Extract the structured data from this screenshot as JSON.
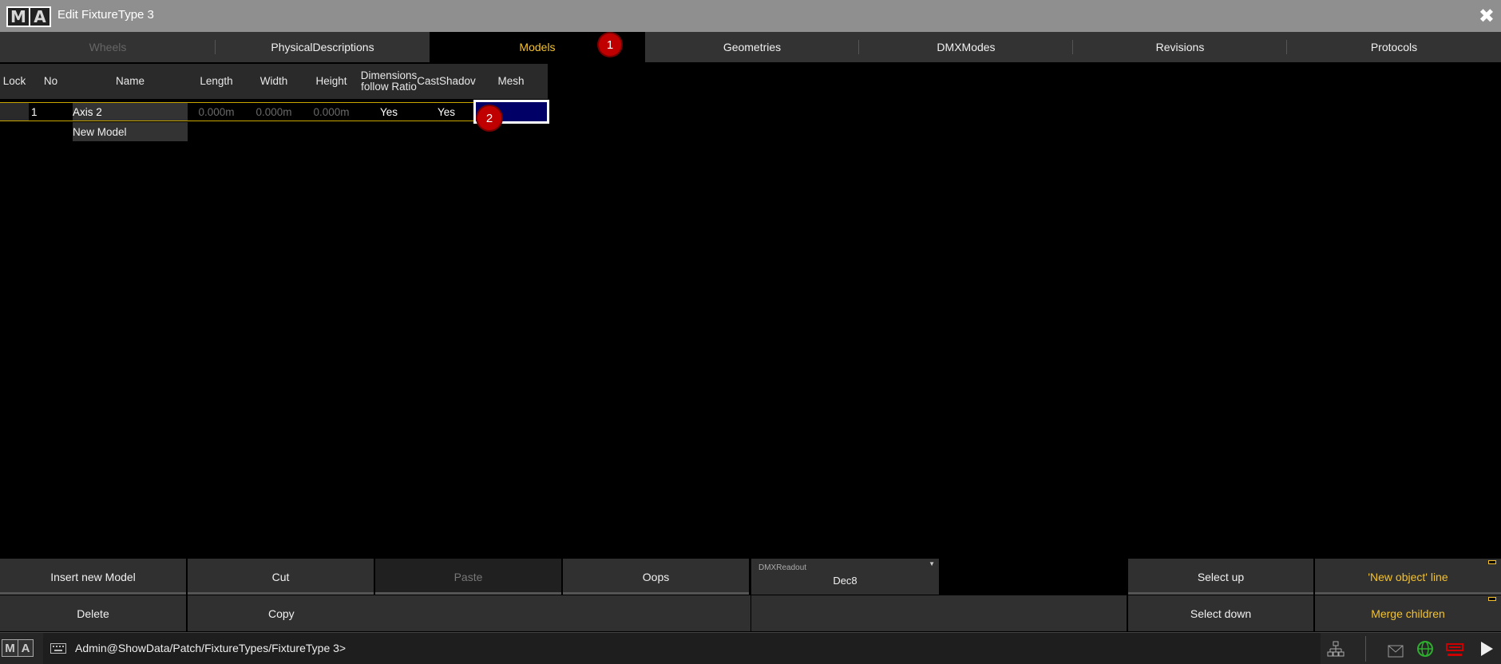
{
  "window": {
    "title": "Edit FixtureType 3",
    "logo_m": "M",
    "logo_a": "A",
    "close_icon": "✖"
  },
  "tabs": [
    {
      "label": "Wheels",
      "state": "disabled"
    },
    {
      "label": "PhysicalDescriptions",
      "state": "normal"
    },
    {
      "label": "Models",
      "state": "active"
    },
    {
      "label": "Geometries",
      "state": "normal"
    },
    {
      "label": "DMXModes",
      "state": "normal"
    },
    {
      "label": "Revisions",
      "state": "normal"
    },
    {
      "label": "Protocols",
      "state": "normal"
    }
  ],
  "badges": [
    "1",
    "2"
  ],
  "grid": {
    "columns": [
      "Lock",
      "No",
      "Name",
      "Length",
      "Width",
      "Height",
      "Dimensions\nfollow Ratio",
      "CastShadov",
      "Mesh"
    ],
    "rows": [
      {
        "lock": "",
        "no": "1",
        "name": "Axis 2",
        "length": "0.000m",
        "width": "0.000m",
        "height": "0.000m",
        "dimensions_follow_ratio": "Yes",
        "cast_shadow": "Yes",
        "mesh": ""
      }
    ],
    "new_row_label": "New Model"
  },
  "toolbar": {
    "insert_new": "Insert new Model",
    "cut": "Cut",
    "paste": "Paste",
    "oops": "Oops",
    "dmx_readout_label": "DMXReadout",
    "dmx_readout_value": "Dec8",
    "select_up": "Select up",
    "new_object_line": "'New object' line",
    "delete": "Delete",
    "copy": "Copy",
    "select_down": "Select down",
    "merge_children": "Merge children"
  },
  "statusbar": {
    "logo_m": "M",
    "logo_a": "A",
    "command_path": "Admin@ShowData/Patch/FixtureTypes/FixtureType 3>"
  },
  "colors": {
    "accent": "#f5c22b",
    "badge": "#c00000",
    "selected_cell": "#000066"
  }
}
